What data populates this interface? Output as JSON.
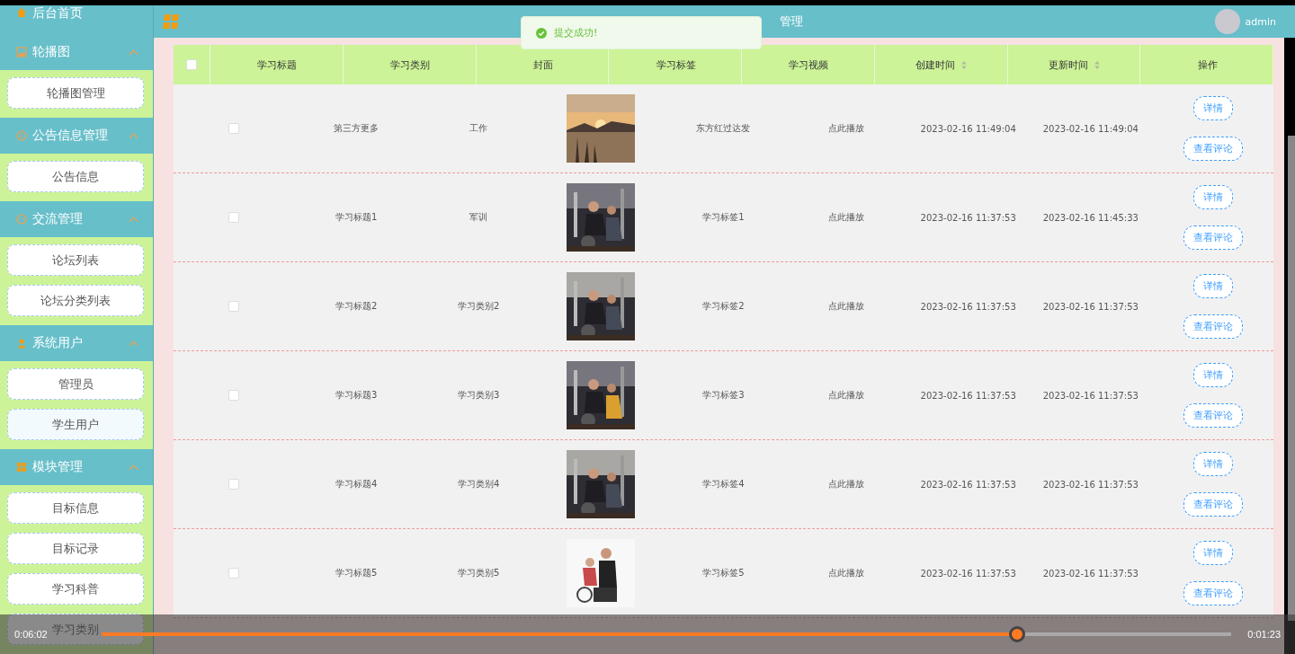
{
  "sidebar": {
    "home": "后台首页",
    "groups": [
      {
        "title": "轮播图",
        "expanded": true,
        "items": [
          {
            "label": "轮播图管理",
            "selected": false
          }
        ]
      },
      {
        "title": "公告信息管理",
        "expanded": true,
        "items": [
          {
            "label": "公告信息",
            "selected": false
          }
        ]
      },
      {
        "title": "交流管理",
        "expanded": true,
        "items": [
          {
            "label": "论坛列表",
            "selected": false
          },
          {
            "label": "论坛分类列表",
            "selected": false
          }
        ]
      },
      {
        "title": "系统用户",
        "expanded": true,
        "items": [
          {
            "label": "管理员",
            "selected": false
          },
          {
            "label": "学生用户",
            "selected": true
          }
        ]
      },
      {
        "title": "模块管理",
        "expanded": true,
        "items": [
          {
            "label": "目标信息",
            "selected": false
          },
          {
            "label": "目标记录",
            "selected": false
          },
          {
            "label": "学习科普",
            "selected": false
          },
          {
            "label": "学习类别",
            "selected": false
          }
        ]
      }
    ]
  },
  "header": {
    "title": "管理",
    "user": "admin"
  },
  "toast": {
    "message": "提交成功!"
  },
  "table": {
    "all_checked": false,
    "columns": [
      {
        "label": "学习标题",
        "sortable": false
      },
      {
        "label": "学习类别",
        "sortable": false
      },
      {
        "label": "封面",
        "sortable": false
      },
      {
        "label": "学习标签",
        "sortable": false
      },
      {
        "label": "学习视频",
        "sortable": false
      },
      {
        "label": "创建时间",
        "sortable": true
      },
      {
        "label": "更新时间",
        "sortable": true
      },
      {
        "label": "操作",
        "sortable": false
      }
    ],
    "rows": [
      {
        "checked": false,
        "title": "第三方更多",
        "category": "工作",
        "tag": "东方红过达发",
        "video": "点此播放",
        "created": "2023-02-16 11:49:04",
        "updated": "2023-02-16 11:49:04",
        "actions": [
          "详情",
          "查看评论"
        ]
      },
      {
        "checked": false,
        "title": "学习标题1",
        "category": "军训",
        "tag": "学习标签1",
        "video": "点此播放",
        "created": "2023-02-16 11:37:53",
        "updated": "2023-02-16 11:45:33",
        "actions": [
          "详情",
          "查看评论"
        ]
      },
      {
        "checked": false,
        "title": "学习标题2",
        "category": "学习类别2",
        "tag": "学习标签2",
        "video": "点此播放",
        "created": "2023-02-16 11:37:53",
        "updated": "2023-02-16 11:37:53",
        "actions": [
          "详情",
          "查看评论"
        ]
      },
      {
        "checked": false,
        "title": "学习标题3",
        "category": "学习类别3",
        "tag": "学习标签3",
        "video": "点此播放",
        "created": "2023-02-16 11:37:53",
        "updated": "2023-02-16 11:37:53",
        "actions": [
          "详情",
          "查看评论"
        ]
      },
      {
        "checked": false,
        "title": "学习标题4",
        "category": "学习类别4",
        "tag": "学习标签4",
        "video": "点此播放",
        "created": "2023-02-16 11:37:53",
        "updated": "2023-02-16 11:37:53",
        "actions": [
          "详情",
          "查看评论"
        ]
      },
      {
        "checked": false,
        "title": "学习标题5",
        "category": "学习类别5",
        "tag": "学习标签5",
        "video": "点此播放",
        "created": "2023-02-16 11:37:53",
        "updated": "2023-02-16 11:37:53",
        "actions": [
          "详情",
          "查看评论"
        ]
      }
    ]
  },
  "player": {
    "elapsed": "0:06:02",
    "remaining": "0:01:23",
    "level": 0.81
  }
}
